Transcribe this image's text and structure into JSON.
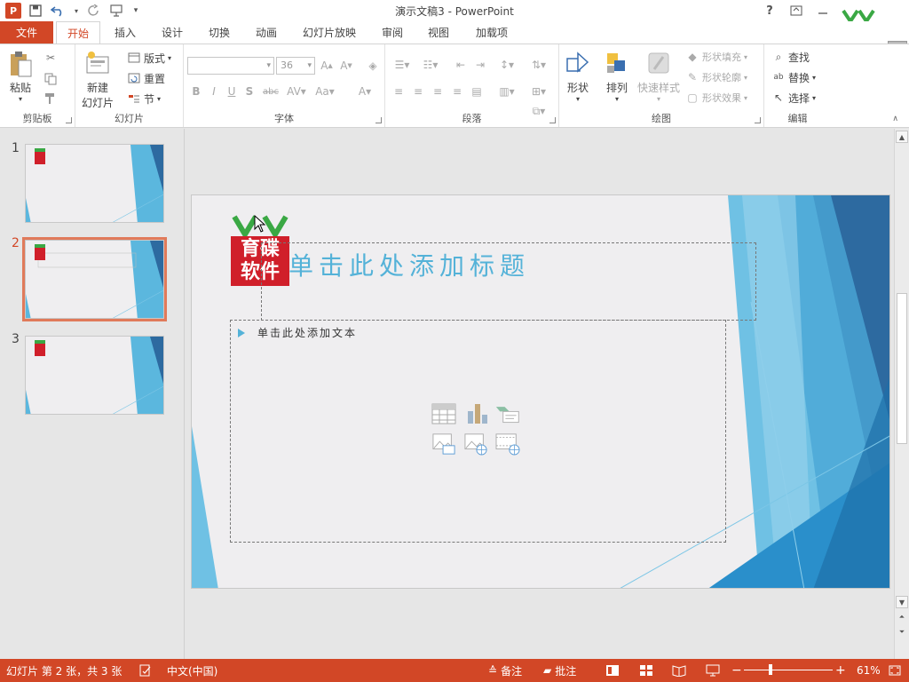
{
  "app": {
    "window_title": "演示文稿3 - PowerPoint",
    "logo_letter": "P",
    "help": "?"
  },
  "tabs": [
    {
      "label": "文件"
    },
    {
      "label": "开始"
    },
    {
      "label": "插入"
    },
    {
      "label": "设计"
    },
    {
      "label": "切换"
    },
    {
      "label": "动画"
    },
    {
      "label": "幻灯片放映"
    },
    {
      "label": "审阅"
    },
    {
      "label": "视图"
    },
    {
      "label": "加载项"
    }
  ],
  "ribbon": {
    "clipboard": {
      "label": "剪贴板",
      "paste": "粘贴"
    },
    "slides": {
      "label": "幻灯片",
      "new_slide_1": "新建",
      "new_slide_2": "幻灯片",
      "layout": "版式",
      "reset": "重置",
      "section": "节"
    },
    "font": {
      "label": "字体",
      "font_name": "",
      "font_size": "36"
    },
    "paragraph": {
      "label": "段落"
    },
    "drawing": {
      "label": "绘图",
      "shape": "形状",
      "arrange": "排列",
      "quick_styles": "快速样式",
      "shape_fill": "形状填充",
      "shape_outline": "形状轮廓",
      "shape_effects": "形状效果"
    },
    "editing": {
      "label": "编辑",
      "find": "查找",
      "replace": "替换",
      "select": "选择"
    }
  },
  "thumbnails": [
    {
      "num": "1"
    },
    {
      "num": "2"
    },
    {
      "num": "3"
    }
  ],
  "slide": {
    "title_placeholder": "单击此处添加标题",
    "body_placeholder": "单击此处添加文本",
    "logo_text_1": "育碟",
    "logo_text_2": "软件"
  },
  "watermark": {
    "line1": "育碟",
    "line2": "软件"
  },
  "statusbar": {
    "slide_info": "幻灯片 第 2 张，共 3 张",
    "language": "中文(中国)",
    "notes": "备注",
    "comments": "批注",
    "zoom": "61%",
    "zoom_level_pct": 61
  },
  "colors": {
    "accent": "#d24726",
    "title_text": "#54b2d8",
    "slide_bg": "#efeef0"
  }
}
